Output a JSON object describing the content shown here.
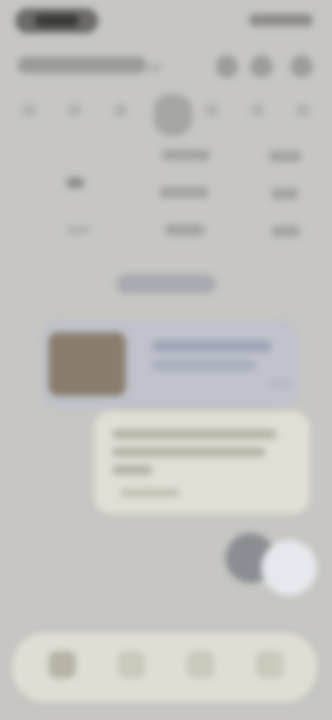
{
  "statusbar": {
    "time": "",
    "icons": ""
  },
  "header": {
    "title": "",
    "actions": [
      "calendar-icon",
      "search-icon",
      "more-icon"
    ]
  },
  "week": {
    "days": [
      "",
      "",
      "",
      "",
      "",
      "",
      ""
    ]
  },
  "chip": {
    "label": ""
  },
  "media_card": {
    "title": "",
    "subtitle": ""
  },
  "message": {
    "text": "",
    "meta": ""
  },
  "fab": {
    "primary": "add-icon",
    "secondary": "edit-icon"
  },
  "bottom_nav": {
    "items": [
      "home-icon",
      "calendar-icon",
      "list-icon",
      "profile-icon"
    ]
  }
}
